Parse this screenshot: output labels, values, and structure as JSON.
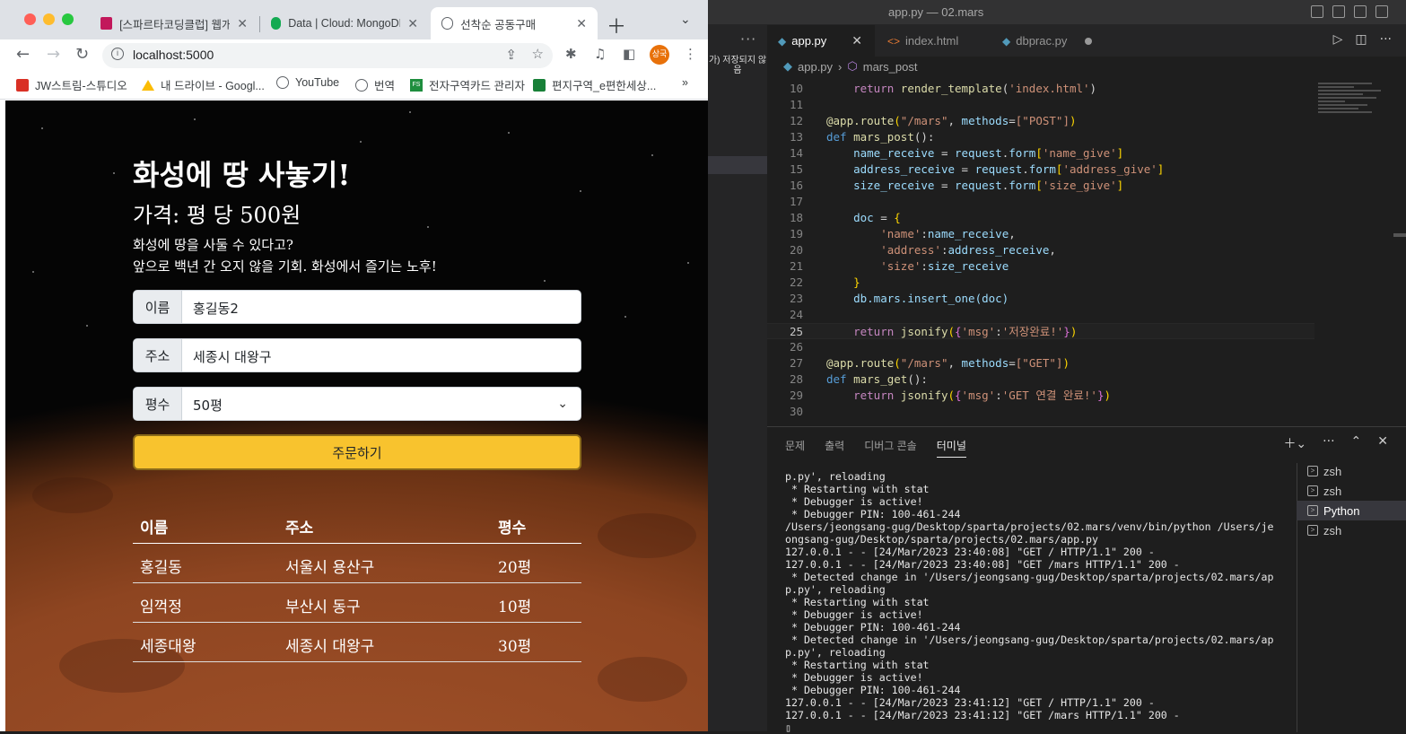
{
  "vscode": {
    "title": "app.py — 02.mars",
    "sidebar_note": "가) 저장되지 않음",
    "tabs": [
      {
        "label": "app.py"
      },
      {
        "label": "index.html"
      },
      {
        "label": "dbprac.py"
      }
    ],
    "breadcrumb": [
      "app.py",
      "mars_post"
    ],
    "code_lines": [
      {
        "num": "10"
      },
      {
        "num": "11"
      },
      {
        "num": "12"
      },
      {
        "num": "13"
      },
      {
        "num": "14"
      },
      {
        "num": "15"
      },
      {
        "num": "16"
      },
      {
        "num": "17"
      },
      {
        "num": "18"
      },
      {
        "num": "19"
      },
      {
        "num": "20"
      },
      {
        "num": "21"
      },
      {
        "num": "22"
      },
      {
        "num": "23"
      },
      {
        "num": "24"
      },
      {
        "num": "25"
      },
      {
        "num": "26"
      },
      {
        "num": "27"
      },
      {
        "num": "28"
      },
      {
        "num": "29"
      },
      {
        "num": "30"
      }
    ],
    "code": {
      "l10": "return render_template('index.html')",
      "l12_route": "\"/mars\"",
      "l12_methods": "[\"POST\"]",
      "l13_fn": "mars_post",
      "l14": "name_receive",
      "l14_key": "'name_give'",
      "l15": "address_receive",
      "l15_key": "'address_give'",
      "l16": "size_receive",
      "l16_key": "'size_give'",
      "l19_key": "'name'",
      "l19_val": "name_receive",
      "l20_key": "'address'",
      "l20_val": "address_receive",
      "l21_key": "'size'",
      "l21_val": "size_receive",
      "l23": "db.mars.insert_one(doc)",
      "l25_msg": "'저장완료!'",
      "l27_methods": "[\"GET\"]",
      "l28_fn": "mars_get",
      "l29_msg": "'GET 연결 완료!'"
    },
    "panel_tabs": [
      "문제",
      "출력",
      "디버그 콘솔",
      "터미널"
    ],
    "terminal_lines": [
      "p.py', reloading",
      " * Restarting with stat",
      " * Debugger is active!",
      " * Debugger PIN: 100-461-244",
      "/Users/jeongsang-gug/Desktop/sparta/projects/02.mars/venv/bin/python /Users/je",
      "ongsang-gug/Desktop/sparta/projects/02.mars/app.py",
      "127.0.0.1 - - [24/Mar/2023 23:40:08] \"GET / HTTP/1.1\" 200 -",
      "127.0.0.1 - - [24/Mar/2023 23:40:08] \"GET /mars HTTP/1.1\" 200 -",
      " * Detected change in '/Users/jeongsang-gug/Desktop/sparta/projects/02.mars/ap",
      "p.py', reloading",
      " * Restarting with stat",
      " * Debugger is active!",
      " * Debugger PIN: 100-461-244",
      " * Detected change in '/Users/jeongsang-gug/Desktop/sparta/projects/02.mars/ap",
      "p.py', reloading",
      " * Restarting with stat",
      " * Debugger is active!",
      " * Debugger PIN: 100-461-244",
      "127.0.0.1 - - [24/Mar/2023 23:41:12] \"GET / HTTP/1.1\" 200 -",
      "127.0.0.1 - - [24/Mar/2023 23:41:12] \"GET /mars HTTP/1.1\" 200 -"
    ],
    "terminals": [
      "zsh",
      "zsh",
      "Python",
      "zsh"
    ]
  },
  "browser": {
    "tabs": [
      {
        "title": "[스파르타코딩클럽] 웹개발"
      },
      {
        "title": "Data | Cloud: MongoDB"
      },
      {
        "title": "선착순 공동구매"
      }
    ],
    "url": "localhost:5000",
    "profile_label": "상국",
    "bookmarks": [
      "JW스트림-스튜디오",
      "내 드라이브 - Googl...",
      "YouTube",
      "번역",
      "전자구역카드 관리자",
      "편지구역_e편한세상..."
    ]
  },
  "page": {
    "title": "화성에 땅 사놓기!",
    "price": "가격: 평 당 500원",
    "desc1": "화성에 땅을 사둘 수 있다고?",
    "desc2": "앞으로 백년 간 오지 않을 기회. 화성에서 즐기는 노후!",
    "name_label": "이름",
    "name_value": "홍길동2",
    "address_label": "주소",
    "address_value": "세종시 대왕구",
    "size_label": "평수",
    "size_value": "50평",
    "order_button": "주문하기",
    "table_headers": [
      "이름",
      "주소",
      "평수"
    ],
    "rows": [
      [
        "홍길동",
        "서울시 용산구",
        "20평"
      ],
      [
        "임꺽정",
        "부산시 동구",
        "10평"
      ],
      [
        "세종대왕",
        "세종시 대왕구",
        "30평"
      ]
    ]
  },
  "colors": {
    "order_button": "#f8c32e",
    "vscode_bg": "#1e1e1e",
    "chrome_tabstrip": "#dee1e6"
  }
}
